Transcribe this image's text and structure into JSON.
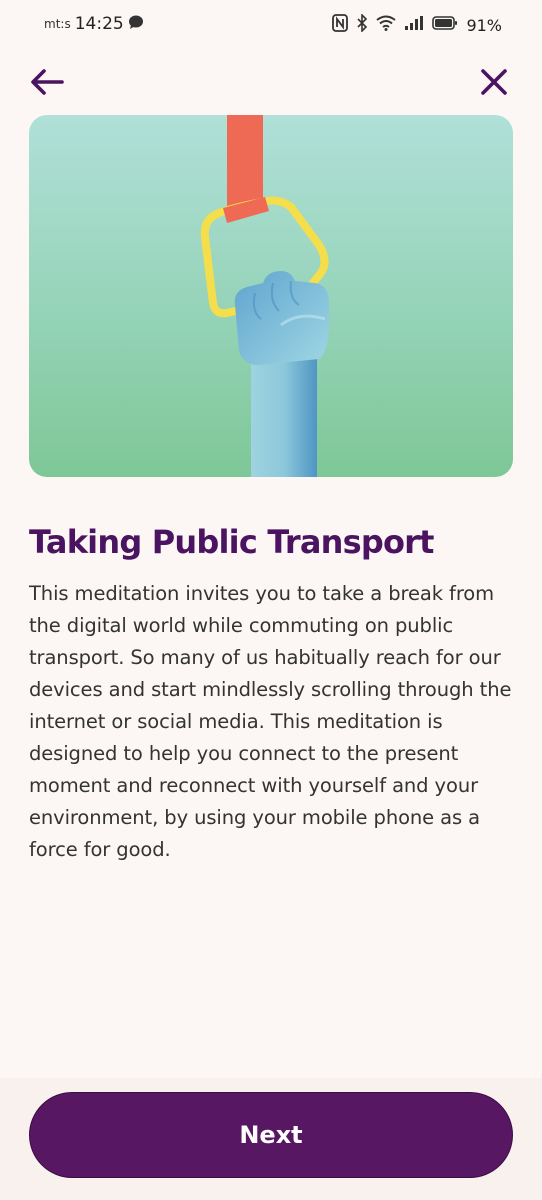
{
  "status_bar": {
    "carrier": "mt:s",
    "time": "14:25",
    "battery_percent": "91%",
    "icons": [
      "chat-bubble-icon",
      "nfc-icon",
      "bluetooth-icon",
      "wifi-icon",
      "signal-icon",
      "battery-icon"
    ]
  },
  "nav": {
    "back_icon": "arrow-left-icon",
    "close_icon": "close-icon"
  },
  "hero": {
    "illustration": "hand-holding-transit-strap-illustration"
  },
  "content": {
    "title": "Taking Public Transport",
    "description": "This meditation invites you to take a break from the digital world while commuting on public transport. So many of us habitually reach for our devices and start mindlessly scrolling through the internet or social media. This meditation is designed to help you connect to the present moment and reconnect with yourself and your environment, by using your mobile phone as a force for good."
  },
  "footer": {
    "next_label": "Next"
  },
  "colors": {
    "background": "#fcf6f4",
    "accent": "#581762",
    "title": "#4a1461",
    "icon": "#4a1461"
  }
}
